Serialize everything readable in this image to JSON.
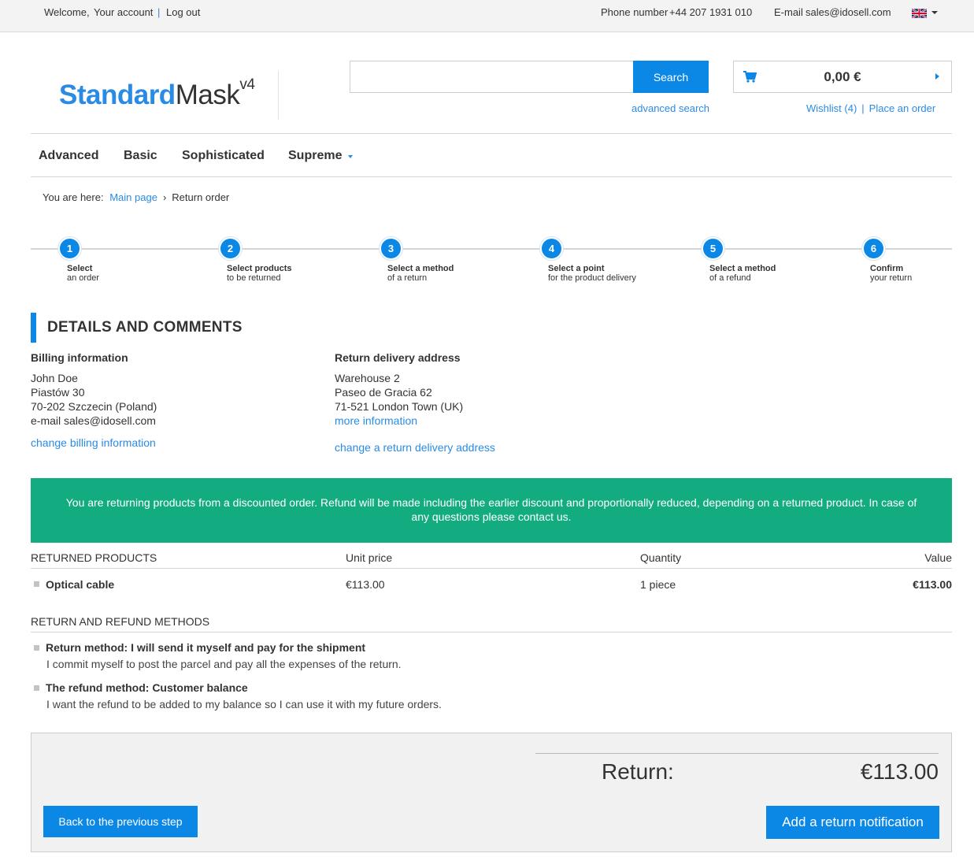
{
  "topbar": {
    "welcome": "Welcome,",
    "your_account": "Your account",
    "separator": "|",
    "log_out": "Log out",
    "phone_label": "Phone number",
    "phone_value": "+44 207 1931 010",
    "email_label": "E-mail",
    "email_value": "sales@idosell.com",
    "language_icon": "uk-flag-icon"
  },
  "header": {
    "logo_part1": "Standard",
    "logo_part2": "Mask",
    "logo_sup": "v4",
    "search_placeholder": "",
    "search_button": "Search",
    "advanced_search": "advanced search",
    "cart_icon": "shopping-cart-icon",
    "cart_total": "0,00 €",
    "wishlist": "Wishlist (4)",
    "links_separator": "|",
    "place_order": "Place an order"
  },
  "nav": {
    "items": [
      "Advanced",
      "Basic",
      "Sophisticated",
      "Supreme"
    ]
  },
  "breadcrumb": {
    "prefix": "You are here:",
    "main_page": "Main page",
    "current": "Return order"
  },
  "steps": [
    {
      "number": "1",
      "title": "Select",
      "subtitle": "an order"
    },
    {
      "number": "2",
      "title": "Select products",
      "subtitle": "to be returned"
    },
    {
      "number": "3",
      "title": "Select a method",
      "subtitle": "of a return"
    },
    {
      "number": "4",
      "title": "Select a point",
      "subtitle": "for the product delivery"
    },
    {
      "number": "5",
      "title": "Select a method",
      "subtitle": "of a refund"
    },
    {
      "number": "6",
      "title": "Confirm",
      "subtitle": "your return"
    }
  ],
  "details": {
    "title": "DETAILS AND COMMENTS",
    "billing": {
      "title": "Billing information",
      "lines": [
        "John Doe",
        "Piastów 30",
        "70-202 Szczecin (Poland)",
        "e-mail sales@idosell.com"
      ],
      "change_link": "change billing information"
    },
    "delivery": {
      "title": "Return delivery address",
      "lines": [
        "Warehouse 2",
        "Paseo de Gracia 62",
        "71-521 London Town (UK)"
      ],
      "more_link": "more information",
      "change_link": "change a return delivery address"
    }
  },
  "notice": {
    "text": "You are returning products from a discounted order. Refund will be made including the earlier discount and proportionally reduced, depending on a returned product. In case of any questions please contact us.",
    "color": "#13ac80"
  },
  "products_table": {
    "headers": {
      "product": "RETURNED PRODUCTS",
      "unit_price": "Unit price",
      "quantity": "Quantity",
      "value": "Value"
    },
    "rows": [
      {
        "name": "Optical cable",
        "unit_price": "€113.00",
        "quantity": "1 piece",
        "value": "€113.00"
      }
    ]
  },
  "methods": {
    "title": "RETURN AND REFUND METHODS",
    "return_method": {
      "title": "Return method: I will send it myself and pay for the shipment",
      "description": "I commit myself to post the parcel and pay all the expenses of the return."
    },
    "refund_method": {
      "title": "The refund method: Customer balance",
      "description": "I want the refund to be added to my balance so I can use it with my future orders."
    }
  },
  "summary": {
    "label": "Return:",
    "value": "€113.00",
    "back_button": "Back to the previous step",
    "submit_button": "Add a return notification"
  },
  "colors": {
    "accent": "#0b87e6",
    "link": "#2a8be5",
    "notice": "#13ac80"
  }
}
